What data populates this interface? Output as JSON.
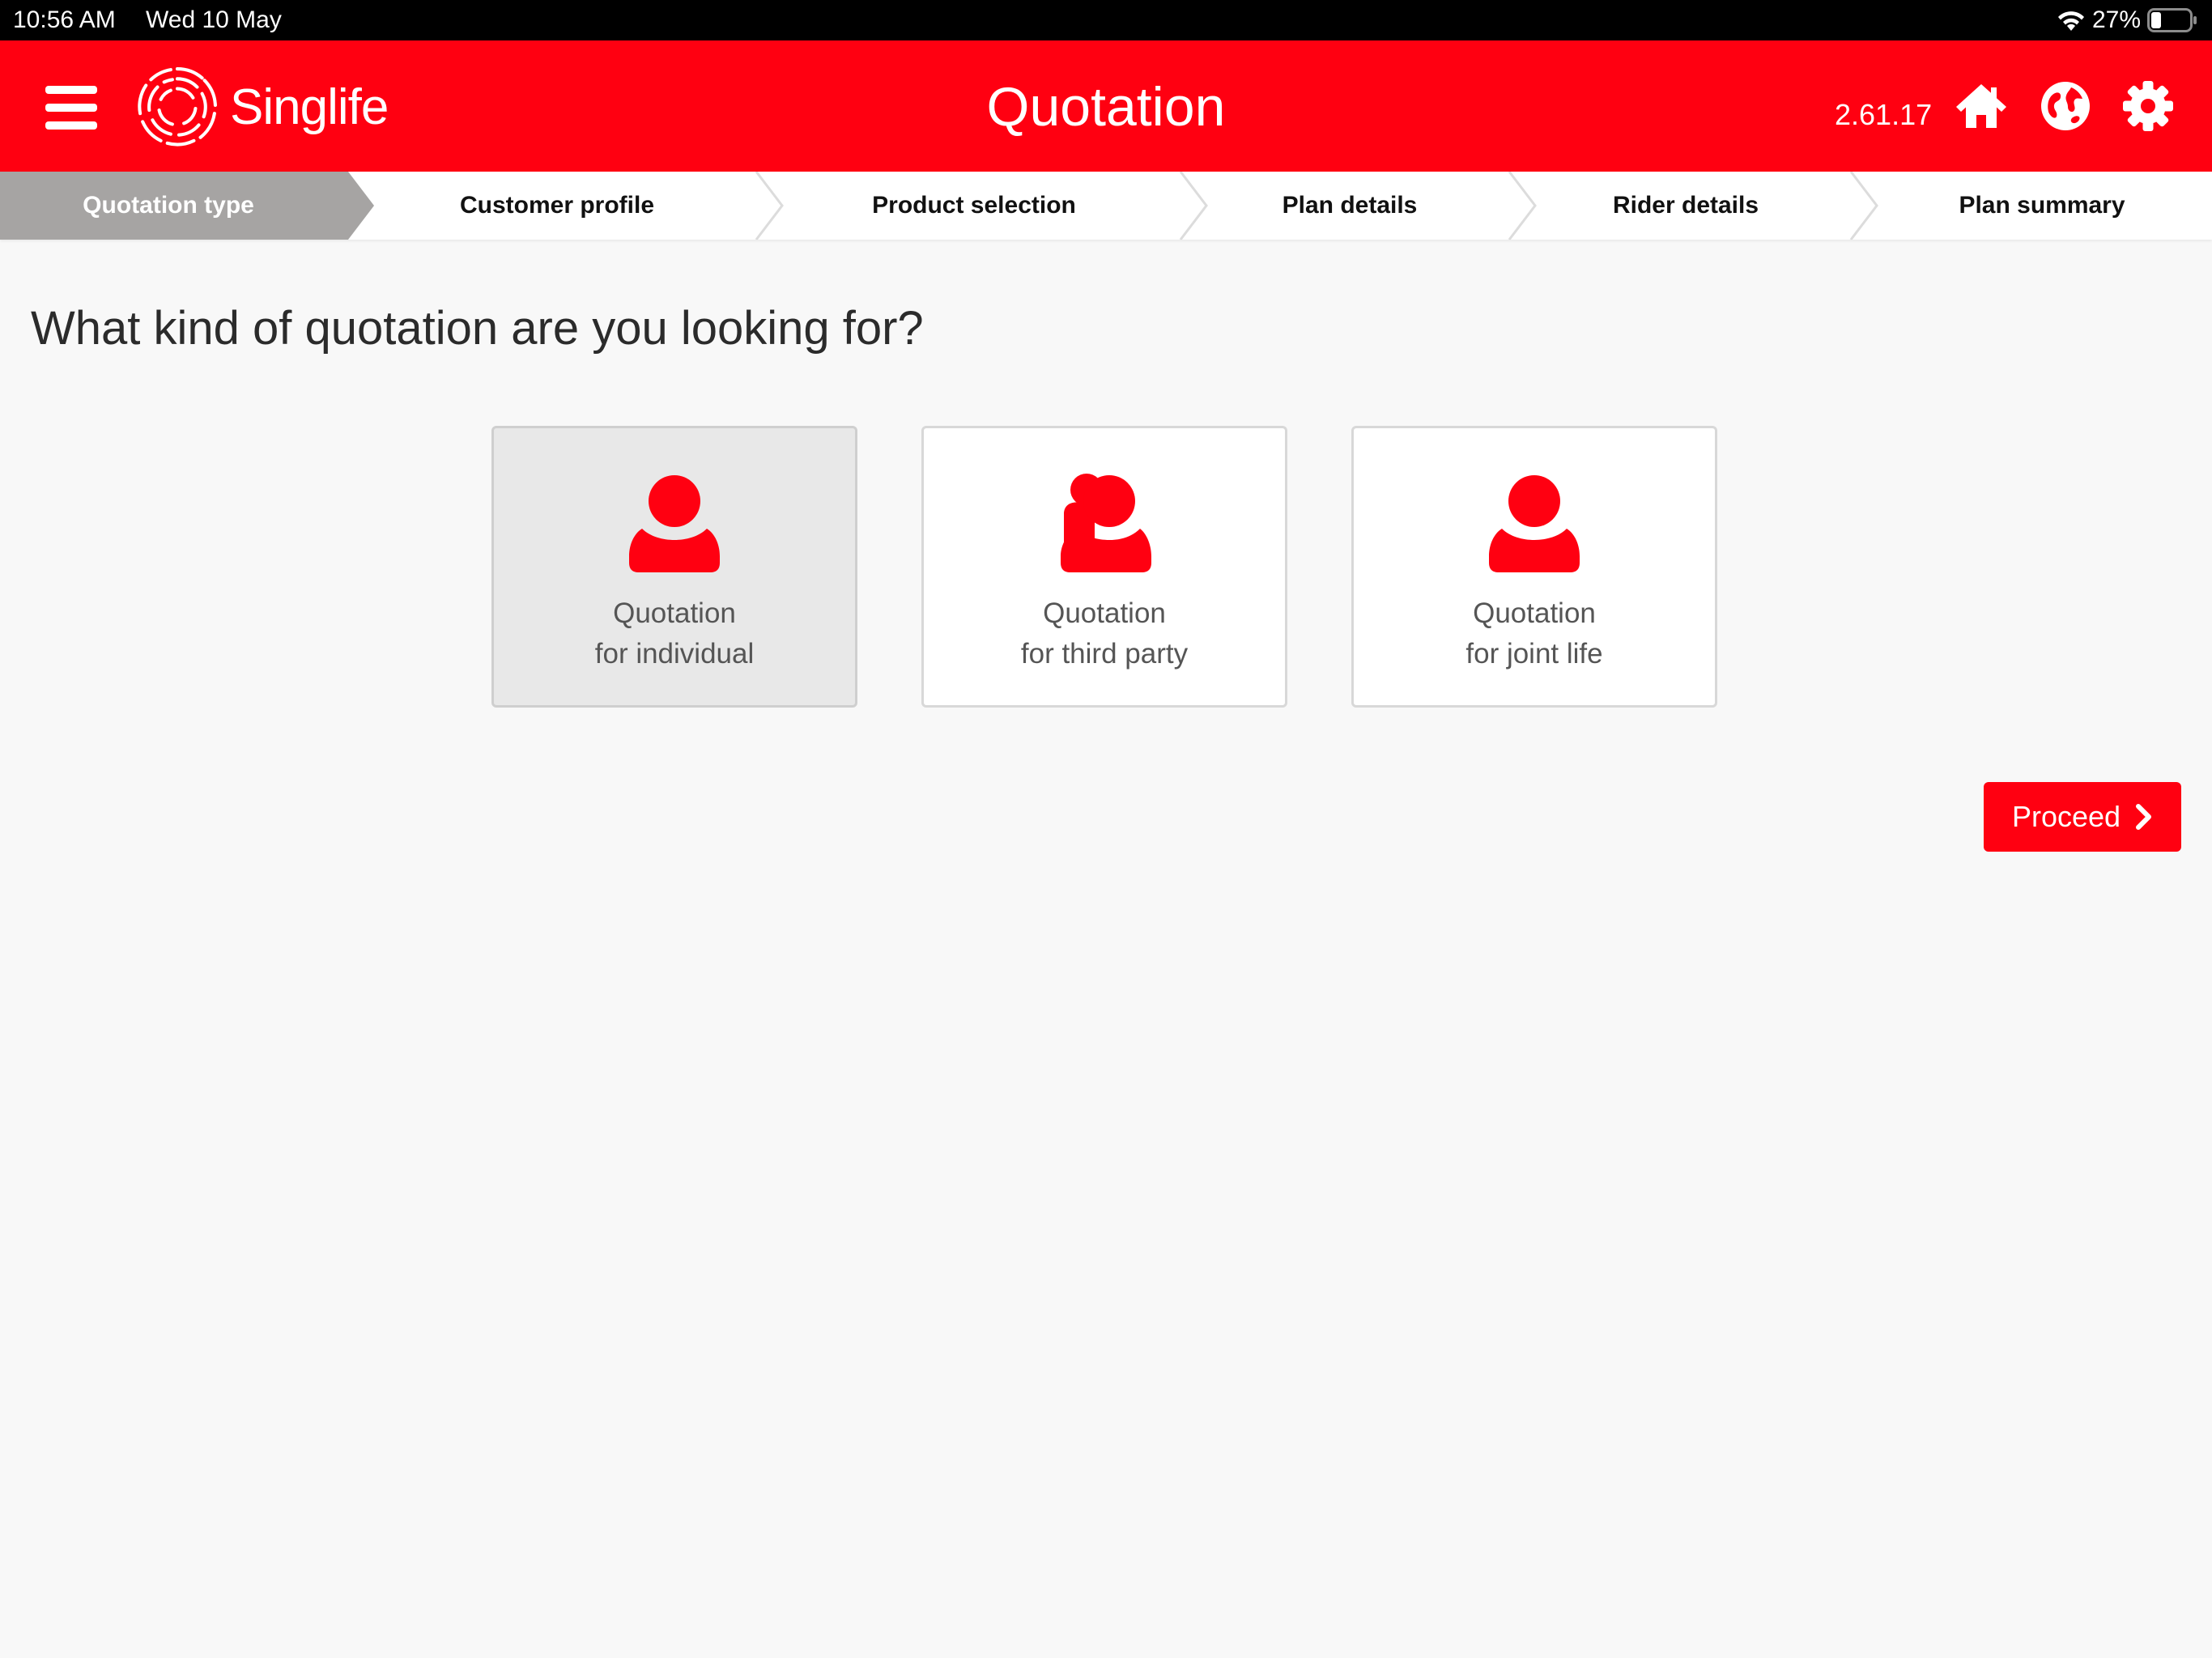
{
  "status_bar": {
    "time": "10:56 AM",
    "date": "Wed 10 May",
    "battery": "27%",
    "battery_level": 0.27
  },
  "header": {
    "brand": "Singlife",
    "title": "Quotation",
    "version": "2.61.17",
    "icons": [
      "menu-icon",
      "home-icon",
      "globe-icon",
      "gear-icon"
    ],
    "accent_color": "#ff0011"
  },
  "stepper": {
    "steps": [
      {
        "label": "Quotation type",
        "state": "active"
      },
      {
        "label": "Customer profile",
        "state": "pending"
      },
      {
        "label": "Product selection",
        "state": "pending"
      },
      {
        "label": "Plan details",
        "state": "pending"
      },
      {
        "label": "Rider details",
        "state": "pending"
      },
      {
        "label": "Plan summary",
        "state": "pending"
      }
    ]
  },
  "main": {
    "question": "What kind of quotation are you looking for?",
    "options": [
      {
        "line1": "Quotation",
        "line2": "for individual",
        "icon": "user-icon",
        "selected": true
      },
      {
        "line1": "Quotation",
        "line2": "for third party",
        "icon": "users-icon",
        "selected": false
      },
      {
        "line1": "Quotation",
        "line2": "for joint life",
        "icon": "user-icon",
        "selected": false
      }
    ],
    "proceed_label": "Proceed"
  }
}
